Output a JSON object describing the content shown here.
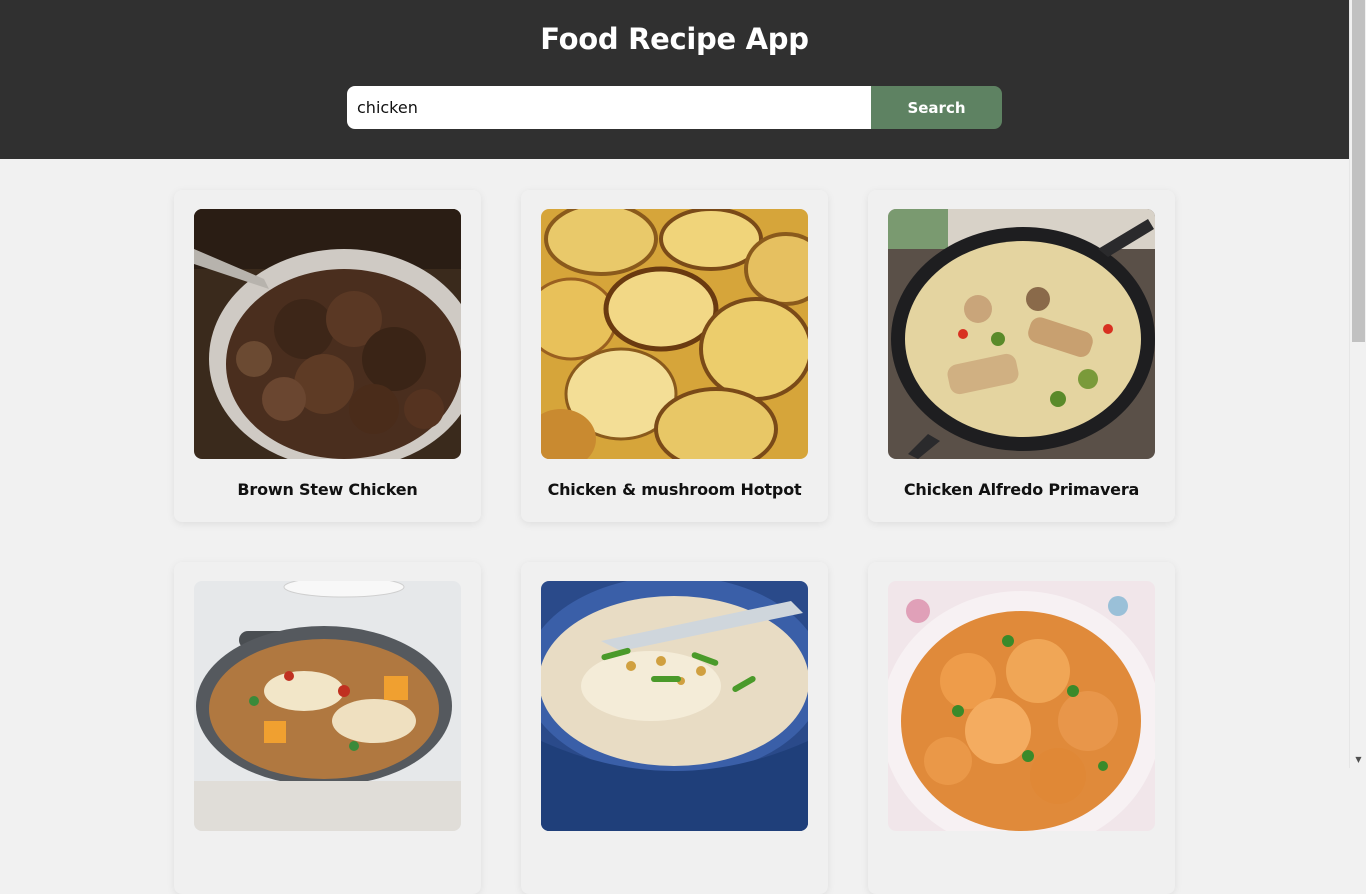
{
  "header": {
    "title": "Food Recipe App"
  },
  "search": {
    "value": "chicken",
    "button_label": "Search"
  },
  "recipes": [
    {
      "title": "Brown Stew Chicken"
    },
    {
      "title": "Chicken & mushroom Hotpot"
    },
    {
      "title": "Chicken Alfredo Primavera"
    },
    {
      "title": ""
    },
    {
      "title": ""
    },
    {
      "title": ""
    }
  ],
  "colors": {
    "header_bg": "#303030",
    "accent": "#5e8262",
    "page_bg": "#f1f1f1"
  },
  "icons": {
    "scroll_down": "▼"
  }
}
